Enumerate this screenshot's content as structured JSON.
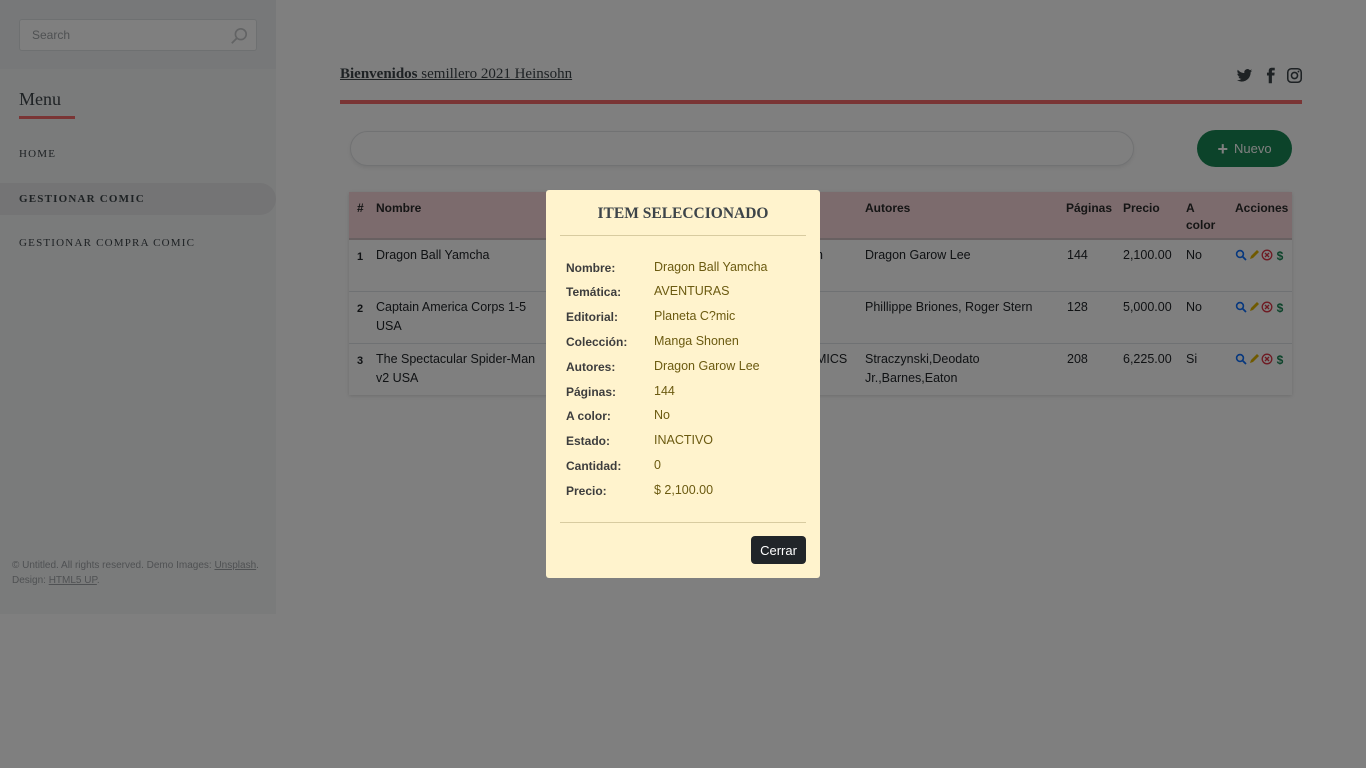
{
  "sidebar": {
    "search_placeholder": "Search",
    "menu_title": "Menu",
    "items": [
      {
        "label": "HOME"
      },
      {
        "label": "GESTIONAR COMIC"
      },
      {
        "label": "GESTIONAR COMPRA COMIC"
      }
    ],
    "footer": {
      "text1": "© Untitled. All rights reserved. Demo Images: ",
      "link1": "Unsplash",
      "text2": ". Design: ",
      "link2": "HTML5 UP",
      "text3": "."
    }
  },
  "header": {
    "title_bold": "Bienvenidos",
    "title_rest": " semillero 2021 Heinsohn",
    "social_icons": [
      "twitter-icon",
      "facebook-icon",
      "instagram-icon"
    ]
  },
  "toolbar": {
    "nuevo_label": "Nuevo"
  },
  "table": {
    "columns": [
      "#",
      "Nombre",
      "Autores",
      "Páginas",
      "Precio",
      "A color",
      "Acciones"
    ],
    "rows": [
      {
        "num": "1",
        "nombre": "Dragon Ball Yamcha",
        "partial": "n",
        "autores": "Dragon Garow Lee",
        "paginas": "144",
        "precio": "2,100.00",
        "color": "No"
      },
      {
        "num": "2",
        "nombre": "Captain America Corps 1-5 USA",
        "partial": "",
        "autores": "Phillippe Briones, Roger Stern",
        "paginas": "128",
        "precio": "5,000.00",
        "color": "No"
      },
      {
        "num": "3",
        "nombre": "The Spectacular Spider-Man v2 USA",
        "partial": "MICS",
        "autores": "Straczynski,Deodato Jr.,Barnes,Eaton",
        "paginas": "208",
        "precio": "6,225.00",
        "color": "Si"
      }
    ]
  },
  "modal": {
    "title": "ITEM SELECCIONADO",
    "fields": [
      {
        "label": "Nombre:",
        "value": "Dragon Ball Yamcha"
      },
      {
        "label": "Temática:",
        "value": "AVENTURAS"
      },
      {
        "label": "Editorial:",
        "value": "Planeta C?mic"
      },
      {
        "label": "Colección:",
        "value": "Manga Shonen"
      },
      {
        "label": "Autores:",
        "value": "Dragon Garow Lee"
      },
      {
        "label": "Páginas:",
        "value": "144"
      },
      {
        "label": "A color:",
        "value": "No"
      },
      {
        "label": "Estado:",
        "value": "INACTIVO"
      },
      {
        "label": "Cantidad:",
        "value": "0"
      },
      {
        "label": "Precio:",
        "value": "$ 2,100.00"
      }
    ],
    "close_label": "Cerrar"
  },
  "colors": {
    "accent": "#f56a6a",
    "success": "#198754",
    "modal_bg": "#fff3cd",
    "table_head": "#f8d7da"
  }
}
